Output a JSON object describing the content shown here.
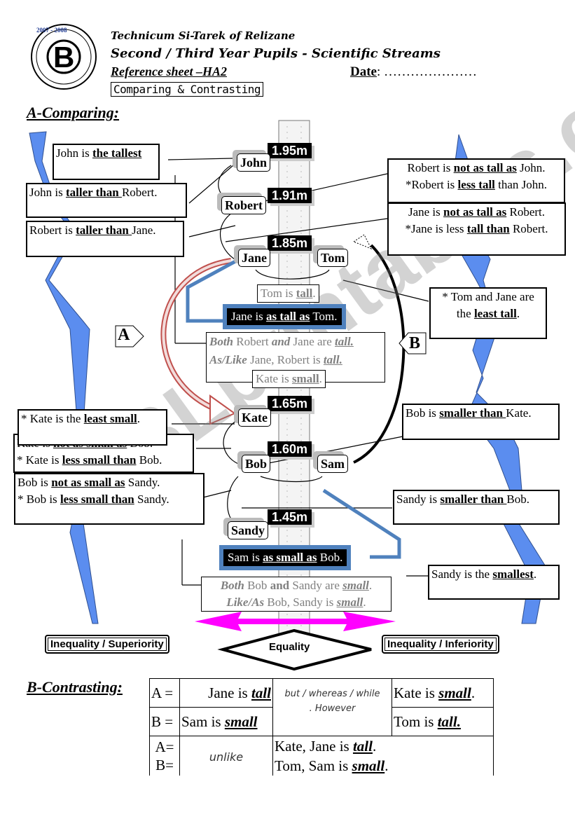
{
  "header": {
    "school": "Technicum Si-Tarek of Relizane",
    "audience": "Second / Third Year Pupils - Scientific Streams",
    "sheet": "Reference sheet –HA2",
    "date_label": "Date",
    "date_value": ": …………………",
    "topic": "Comparing & Contrasting",
    "logo": {
      "letter": "B",
      "years": "2007 - 2008"
    }
  },
  "comparing": {
    "title": "A-Comparing:",
    "people": [
      {
        "name": "John",
        "height": "1.95m"
      },
      {
        "name": "Robert",
        "height": "1.91m"
      },
      {
        "name": "Jane",
        "height": "1.85m"
      },
      {
        "name": "Tom",
        "height": ""
      },
      {
        "name": "Kate",
        "height": "1.65m"
      },
      {
        "name": "Bob",
        "height": "1.60m"
      },
      {
        "name": "Sam",
        "height": ""
      },
      {
        "name": "Sandy",
        "height": "1.45m"
      }
    ],
    "left_boxes": [
      {
        "pre": "John is ",
        "key": "the tallest",
        "post": ""
      },
      {
        "pre": "John is ",
        "key": "taller than ",
        "post": "Robert."
      },
      {
        "pre": "Robert is ",
        "key": "taller than ",
        "post": "Jane."
      },
      {
        "pre": "* Kate is the ",
        "key": "least small",
        "post": "."
      },
      {
        "pre": "Kate is ",
        "key": "not as small as",
        "post": " Bob.",
        "pre2": "* Kate is ",
        "key2": "less small than",
        "post2": " Bob."
      },
      {
        "pre": "Bob is ",
        "key": "not as small as",
        "post": " Sandy.",
        "pre2": "* Bob is ",
        "key2": "less small than",
        "post2": " Sandy."
      }
    ],
    "right_boxes": [
      {
        "pre": "Robert is ",
        "key": "not as tall as",
        "post": " John.",
        "pre2": "*Robert is ",
        "key2": "less tall",
        "post2": " than John."
      },
      {
        "pre": "Jane is ",
        "key": "not as tall as",
        "post": " Robert.",
        "pre2": "*Jane is less ",
        "key2": "tall than",
        "post2": " Robert."
      },
      {
        "pre": "* Tom and Jane are",
        "key": "",
        "post": "",
        "pre2": "the ",
        "key2": "least tall",
        "post2": "."
      },
      {
        "pre": "Bob is ",
        "key": "smaller than ",
        "post": "Kate."
      },
      {
        "pre": "Sandy is ",
        "key": "smaller than ",
        "post": "Bob."
      },
      {
        "pre": "Sandy is the ",
        "key": "smallest",
        "post": "."
      }
    ],
    "center": {
      "tom_tall": {
        "pre": "Tom is ",
        "key": "tall",
        "post": "."
      },
      "jane_eq": {
        "pre": "Jane is ",
        "key": "as tall as",
        "post": " Tom."
      },
      "both_tall": {
        "a": "Both",
        "b": " Robert ",
        "c": "and",
        "d": " Jane are ",
        "e": "tall."
      },
      "like_tall": {
        "a": "As/Like",
        "b": " Jane, Robert is ",
        "e": "tall."
      },
      "kate_small": {
        "pre": "Kate is ",
        "key": "small",
        "post": "."
      },
      "sam_eq": {
        "pre": "Sam is ",
        "key": "as small as",
        "post": " Bob."
      },
      "both_small": {
        "a": "Both",
        "b": " Bob ",
        "c": "and",
        "d": " Sandy are ",
        "e": "small",
        "f": "."
      },
      "like_small": {
        "a": "Like/As",
        "b": " Bob, Sandy is ",
        "e": "small",
        "f": "."
      }
    },
    "side_labels": {
      "a": "A",
      "b": "B"
    },
    "tags": {
      "left": "Inequality / Superiority",
      "middle": "Equality",
      "right": "Inequality / Inferiority"
    },
    "colors": {
      "zigzag": "#5b8def",
      "pink_arrow": "#ff00ff",
      "blue_frame": "#4f81bd",
      "red_arrow": "#c0504d"
    }
  },
  "contrasting": {
    "title": "B-Contrasting:",
    "rows": [
      {
        "label": "A =",
        "left_pre": "Jane is ",
        "left_key": "tall",
        "connector": "but / whereas / while",
        "right_pre": "Kate is ",
        "right_key": "small",
        "right_post": "."
      },
      {
        "label": "B =",
        "left_pre": "Sam is ",
        "left_key": "small",
        "connector": ". However",
        "right_pre": "Tom is ",
        "right_key": "tall.",
        "right_post": ""
      }
    ],
    "unlike_row": {
      "label_a": "A=",
      "label_b": "B=",
      "connector": "unlike",
      "line1_pre": "Kate, Jane is ",
      "line1_key": "tall",
      "line1_post": ".",
      "line2_pre": "Tom, Sam is ",
      "line2_key": "small",
      "line2_post": "."
    }
  },
  "watermark": "ESLprintables.com"
}
